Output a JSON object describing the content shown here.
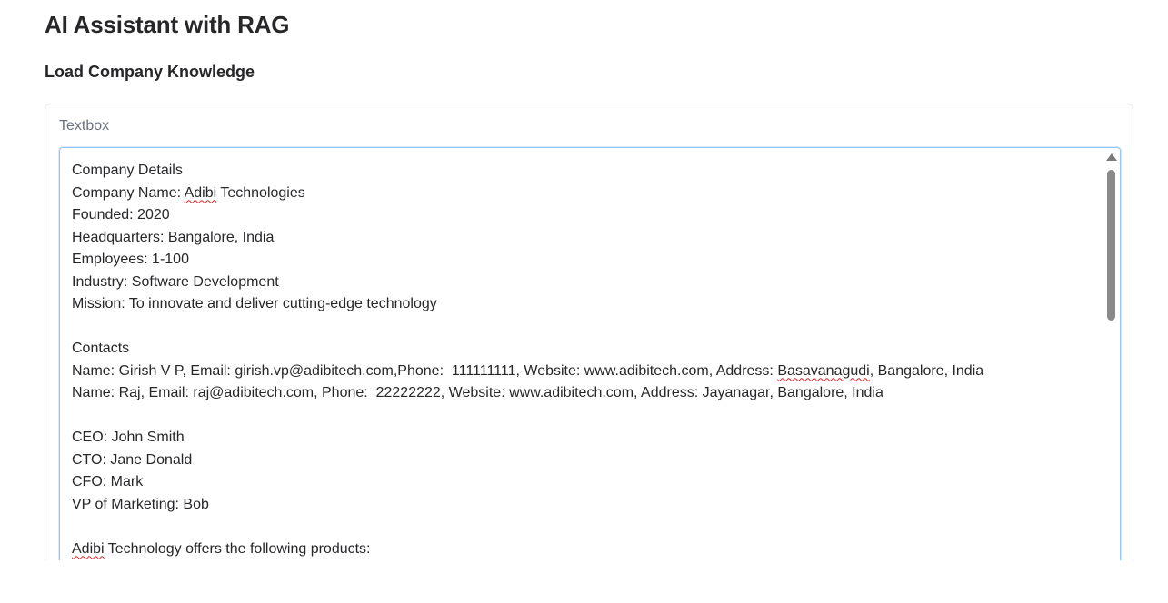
{
  "app": {
    "title": "AI Assistant with RAG"
  },
  "section": {
    "title": "Load Company Knowledge"
  },
  "textbox": {
    "label": "Textbox",
    "lines": [
      "Company Details",
      "Company Name: Adibi Technologies",
      "Founded: 2020",
      "Headquarters: Bangalore, India",
      "Employees: 1-100",
      "Industry: Software Development",
      "Mission: To innovate and deliver cutting-edge technology",
      "",
      "Contacts",
      "Name: Girish V P, Email: girish.vp@adibitech.com,Phone:  111111111, Website: www.adibitech.com, Address: Basavanagudi, Bangalore, India",
      "Name: Raj, Email: raj@adibitech.com, Phone:  22222222, Website: www.adibitech.com, Address: Jayanagar, Bangalore, India",
      "",
      "CEO: John Smith",
      "CTO: Jane Donald",
      "CFO: Mark",
      "VP of Marketing: Bob",
      "",
      "Adibi Technology offers the following products:"
    ]
  },
  "colors": {
    "focus_border": "#93c5fd",
    "spellcheck": "#dc2626",
    "label": "#6b7280"
  },
  "icons": {
    "scroll_up": "scroll-up-arrow-icon"
  }
}
